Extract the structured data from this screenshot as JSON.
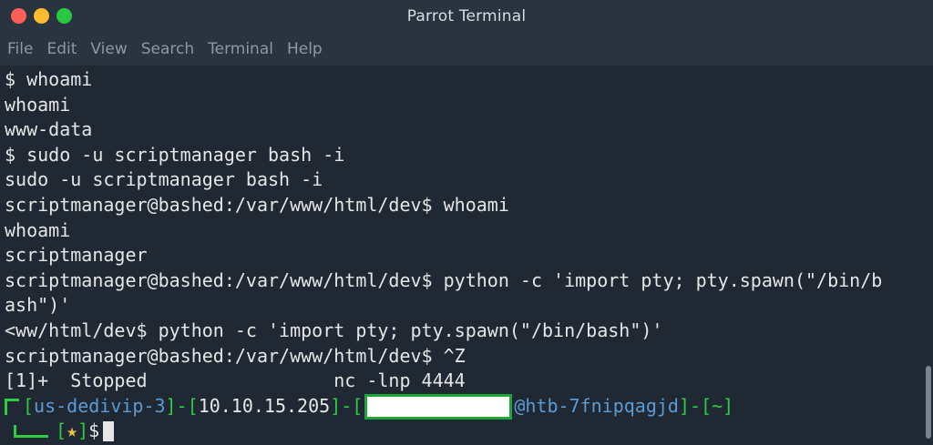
{
  "window": {
    "title": "Parrot Terminal",
    "buttons": {
      "close_color": "#ff5f57",
      "minimize_color": "#febc2e",
      "maximize_color": "#28c840"
    }
  },
  "menubar": {
    "items": [
      "File",
      "Edit",
      "View",
      "Search",
      "Terminal",
      "Help"
    ]
  },
  "terminal": {
    "lines": [
      "$ whoami",
      "whoami",
      "www-data",
      "$ sudo -u scriptmanager bash -i",
      "sudo -u scriptmanager bash -i",
      "scriptmanager@bashed:/var/www/html/dev$ whoami",
      "whoami",
      "scriptmanager",
      "scriptmanager@bashed:/var/www/html/dev$ python -c 'import pty; pty.spawn(\"/bin/b",
      "ash\")'",
      "<ww/html/dev$ python -c 'import pty; pty.spawn(\"/bin/bash\")'",
      "scriptmanager@bashed:/var/www/html/dev$ ^Z",
      "[1]+  Stopped                 nc -lnp 4444"
    ],
    "prompt": {
      "host_segment": "us-dedivip-3",
      "ip_segment": "10.10.15.205",
      "at_host": "@htb-7fnipqagjd",
      "dir_segment": "~",
      "dash": "-",
      "open_bracket": "[",
      "close_bracket": "]",
      "star": "★",
      "dollar": "$"
    }
  }
}
